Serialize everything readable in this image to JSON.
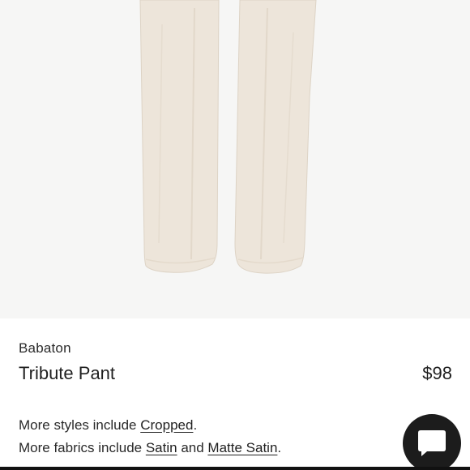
{
  "product": {
    "brand": "Babaton",
    "name": "Tribute Pant",
    "price": "$98"
  },
  "more_styles": {
    "prefix": "More styles include ",
    "links": [
      "Cropped"
    ],
    "suffix": "."
  },
  "more_fabrics": {
    "prefix": "More fabrics include ",
    "link1": "Satin",
    "joiner": " and ",
    "link2": "Matte Satin",
    "suffix": "."
  },
  "icons": {
    "chat": "chat-bubble-icon"
  },
  "colors": {
    "pant": "#ede5da",
    "background": "#f6f6f5",
    "chat_button": "#1c1c1c"
  }
}
